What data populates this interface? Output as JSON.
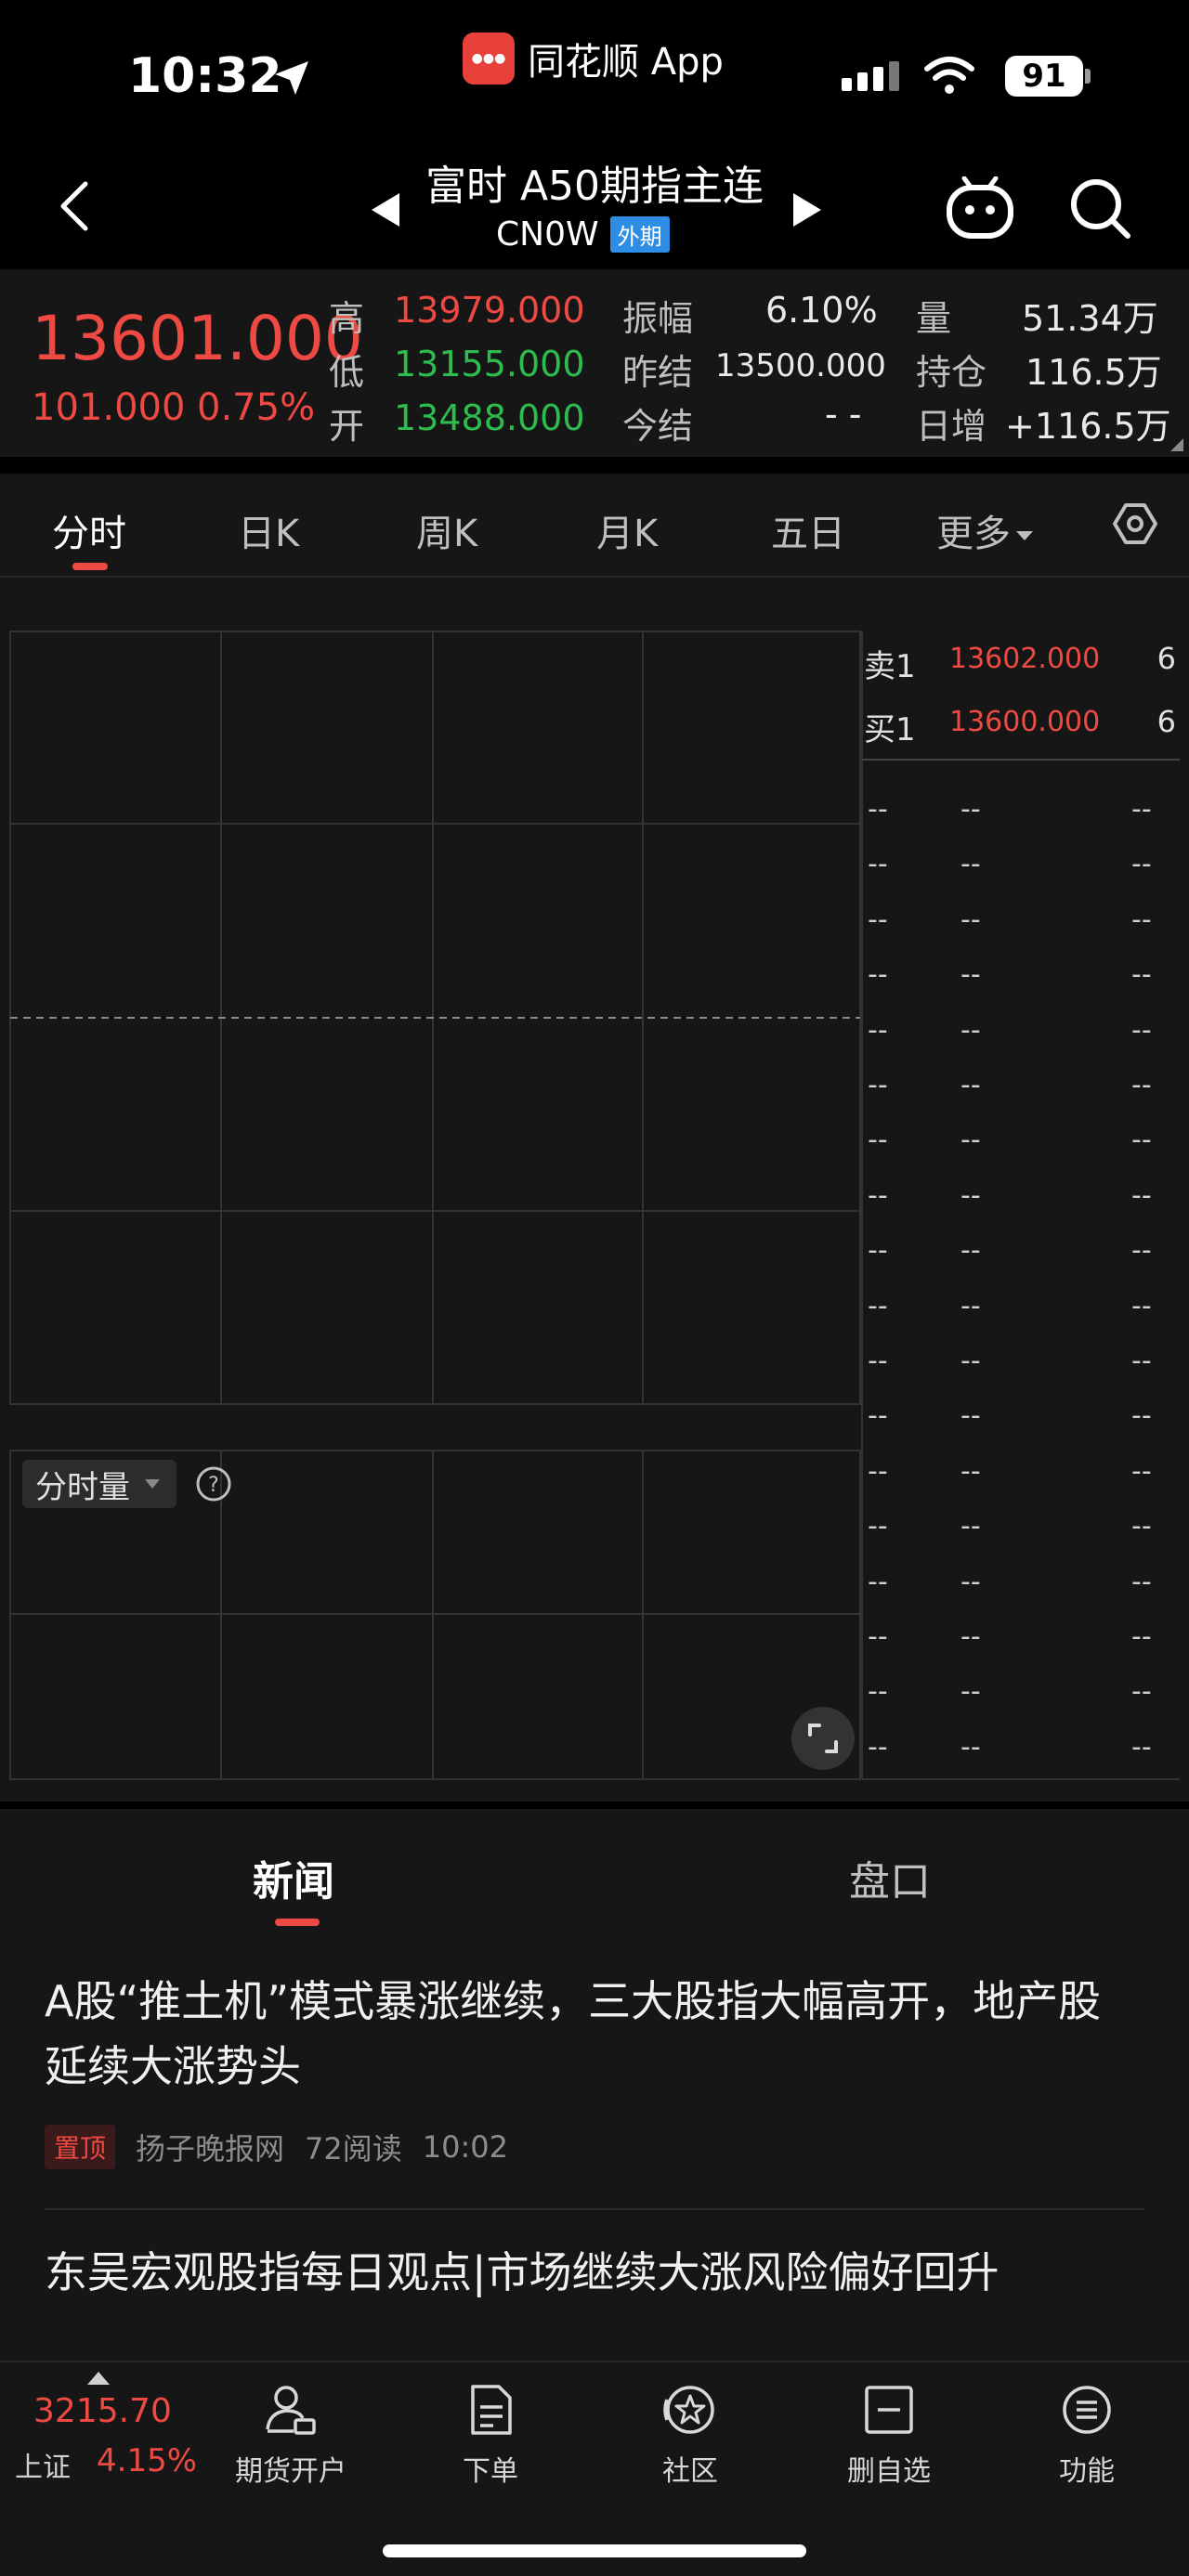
{
  "status_bar": {
    "time": "10:32",
    "app_name": "同花顺 App",
    "battery": "91",
    "icons": [
      "location-arrow-icon",
      "signal-icon",
      "wifi-icon",
      "battery-icon"
    ]
  },
  "header": {
    "title": "富时 A50期指主连",
    "code": "CN0W",
    "tag": "外期",
    "icons": [
      "back-icon",
      "prev-arrow-icon",
      "next-arrow-icon",
      "robot-icon",
      "search-icon"
    ]
  },
  "quote": {
    "price": "13601.000",
    "change": "101.000",
    "change_pct": "0.75%",
    "high_label": "高",
    "high": "13979.000",
    "low_label": "低",
    "low": "13155.000",
    "open_label": "开",
    "open": "13488.000",
    "amplitude_label": "振幅",
    "amplitude": "6.10%",
    "prev_settle_label": "昨结",
    "prev_settle": "13500.000",
    "today_settle_label": "今结",
    "today_settle": "- -",
    "volume_label": "量",
    "volume": "51.34万",
    "open_interest_label": "持仓",
    "open_interest": "116.5万",
    "daily_increase_label": "日增",
    "daily_increase": "+116.5万"
  },
  "chart_tabs": {
    "items": [
      "分时",
      "日K",
      "周K",
      "月K",
      "五日"
    ],
    "more": "更多",
    "active": 0
  },
  "volume_selector": {
    "label": "分时量"
  },
  "order_book": {
    "ask": {
      "label": "卖1",
      "price": "13602.000",
      "volume": "6"
    },
    "bid": {
      "label": "买1",
      "price": "13600.000",
      "volume": "6"
    },
    "placeholder": "--"
  },
  "news_tabs": {
    "news": "新闻",
    "book": "盘口"
  },
  "news": [
    {
      "title": "A股“推土机”模式暴涨继续，三大股指大幅高开，地产股延续大涨势头",
      "badge": "置顶",
      "source": "扬子晚报网",
      "reads": "72阅读",
      "time": "10:02"
    },
    {
      "title": "东吴宏观股指每日观点|市场继续大涨风险偏好回升"
    }
  ],
  "bottom_nav": {
    "index_value": "3215.70",
    "index_name": "上证",
    "index_pct": "4.15%",
    "items": [
      "期货开户",
      "下单",
      "社区",
      "删自选",
      "功能"
    ]
  },
  "colors": {
    "up": "#ee4a43",
    "down": "#2dbc4e",
    "tag_blue": "#2e8ee6",
    "panel": "#161616"
  }
}
